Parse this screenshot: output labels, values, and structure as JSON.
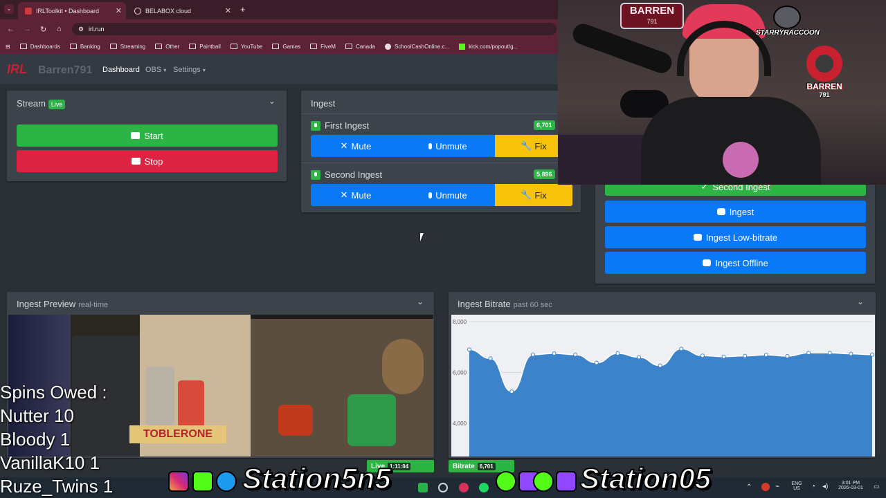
{
  "browser": {
    "tabs": [
      {
        "title": "IRLToolkit • Dashboard",
        "active": true
      },
      {
        "title": "BELABOX cloud",
        "active": false
      }
    ],
    "url": "irl.run",
    "bookmarks": [
      "Dashboards",
      "Banking",
      "Streaming",
      "Other",
      "Paintball",
      "YouTube",
      "Games",
      "FiveM",
      "Canada",
      "SchoolCashOnline.c...",
      "kick.com/popout/g..."
    ]
  },
  "app": {
    "brand": "Barren791",
    "logo": "IRL",
    "nav": {
      "dashboard": "Dashboard",
      "obs": "OBS",
      "settings": "Settings"
    }
  },
  "stream": {
    "title": "Stream",
    "badge": "Live",
    "start": "Start",
    "stop": "Stop"
  },
  "ingest": {
    "title": "Ingest",
    "items": [
      {
        "name": "First Ingest",
        "bitrate": "6,701",
        "mute": "Mute",
        "unmute": "Unmute",
        "fix": "Fix"
      },
      {
        "name": "Second Ingest",
        "bitrate": "5,896",
        "mute": "Mute",
        "unmute": "Unmute",
        "fix": "Fix"
      }
    ]
  },
  "scenes": {
    "buttons": [
      "Second Ingest",
      "Ingest",
      "Ingest Low-bitrate",
      "Ingest Offline"
    ]
  },
  "preview": {
    "title": "Ingest Preview",
    "subtitle": "real-time"
  },
  "bitrate_panel": {
    "title": "Ingest Bitrate",
    "subtitle": "past 60 sec"
  },
  "chart_data": {
    "type": "area",
    "title": "Ingest Bitrate",
    "subtitle": "past 60 sec",
    "ytick_labels": [
      "8,000",
      "6,000",
      "4,000"
    ],
    "ylim": [
      3600,
      8000
    ],
    "grid": true,
    "color": "#3d83c9",
    "series": [
      {
        "values": [
          6900,
          6550,
          5250,
          6700,
          6750,
          6700,
          6380,
          6750,
          6600,
          6270,
          6930,
          6660,
          6620,
          6650,
          6690,
          6640,
          6770,
          6770,
          6730,
          6700
        ]
      }
    ]
  },
  "statusbar": {
    "live_label": "Live",
    "live_time": "1:11:04",
    "bitrate_label": "Bitrate",
    "bitrate_value": "6,701"
  },
  "overlay": {
    "spins_title": "Spins Owed :",
    "spins": [
      "Nutter 10",
      "Bloody 1",
      "VanillaK10 1",
      "Ruze_Twins 1"
    ],
    "station_left": "Station5n5",
    "station_right": "Station05"
  },
  "webcam": {
    "sign_top": "BARREN",
    "sign_top_sub": "791",
    "logo_right": "STARRYRACCOON",
    "logo_barren": "BARREN",
    "logo_barren_sub": "791"
  },
  "taskbar": {
    "lang_top": "ENG",
    "lang_bottom": "US",
    "time": "3:01 PM",
    "date": "2026-03-01"
  }
}
